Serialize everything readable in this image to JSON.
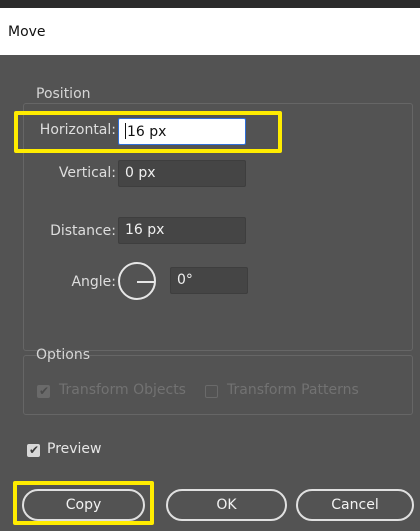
{
  "window": {
    "title": "Move"
  },
  "position": {
    "group_label": "Position",
    "horizontal": {
      "label": "Horizontal:",
      "value": "16 px"
    },
    "vertical": {
      "label": "Vertical:",
      "value": "0 px"
    },
    "distance": {
      "label": "Distance:",
      "value": "16 px"
    },
    "angle": {
      "label": "Angle:",
      "value": "0°"
    }
  },
  "options": {
    "group_label": "Options",
    "transform_objects": {
      "label": "Transform Objects",
      "checked": true,
      "enabled": false
    },
    "transform_patterns": {
      "label": "Transform Patterns",
      "checked": false,
      "enabled": false
    }
  },
  "preview": {
    "label": "Preview",
    "checked": true
  },
  "buttons": {
    "copy": "Copy",
    "ok": "OK",
    "cancel": "Cancel"
  },
  "colors": {
    "highlight": "#ffec00",
    "dialog_bg": "#535353",
    "field_bg": "#454545"
  }
}
